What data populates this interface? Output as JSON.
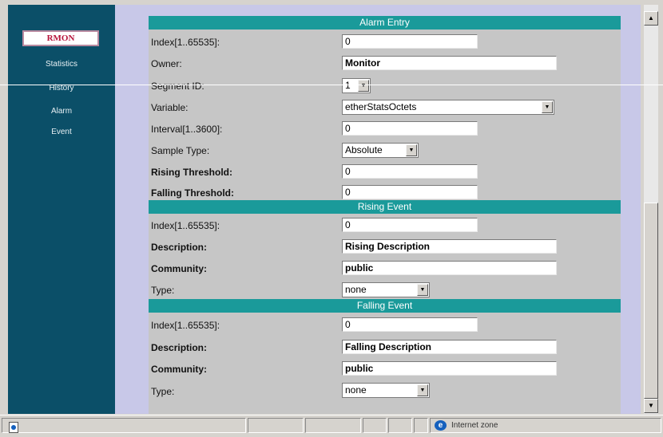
{
  "sidebar": {
    "active": "RMON",
    "items": [
      "Statistics",
      "History",
      "Alarm",
      "Event"
    ]
  },
  "alarm_entry": {
    "header": "Alarm Entry",
    "index_label": "Index[1..65535]:",
    "index_value": "0",
    "owner_label": "Owner:",
    "owner_value": "Monitor",
    "segment_label": "Segment ID:",
    "segment_value": "1",
    "variable_label": "Variable:",
    "variable_value": "etherStatsOctets",
    "interval_label": "Interval[1..3600]:",
    "interval_value": "0",
    "sample_type_label": "Sample Type:",
    "sample_type_value": "Absolute",
    "rising_threshold_label": "Rising Threshold:",
    "rising_threshold_value": "0",
    "falling_threshold_label": "Falling Threshold:",
    "falling_threshold_value": "0"
  },
  "rising_event": {
    "header": "Rising Event",
    "index_label": "Index[1..65535]:",
    "index_value": "0",
    "description_label": "Description:",
    "description_value": "Rising Description",
    "community_label": "Community:",
    "community_value": "public",
    "type_label": "Type:",
    "type_value": "none"
  },
  "falling_event": {
    "header": "Falling Event",
    "index_label": "Index[1..65535]:",
    "index_value": "0",
    "description_label": "Description:",
    "description_value": "Falling Description",
    "community_label": "Community:",
    "community_value": "public",
    "type_label": "Type:",
    "type_value": "none"
  },
  "statusbar": {
    "zone": "Internet zone"
  },
  "icons": {
    "scroll_up": "scroll-up-arrow-icon",
    "scroll_down": "scroll-down-arrow-icon",
    "ie": "internet-explorer-icon",
    "page": "page-icon"
  },
  "colors": {
    "sidebar": "#0b4f68",
    "section_bar": "#1a9a9a",
    "content_bg": "#c8c8e8",
    "panel_bg": "#c6c6c6",
    "active_nav_text": "#b8143c"
  }
}
